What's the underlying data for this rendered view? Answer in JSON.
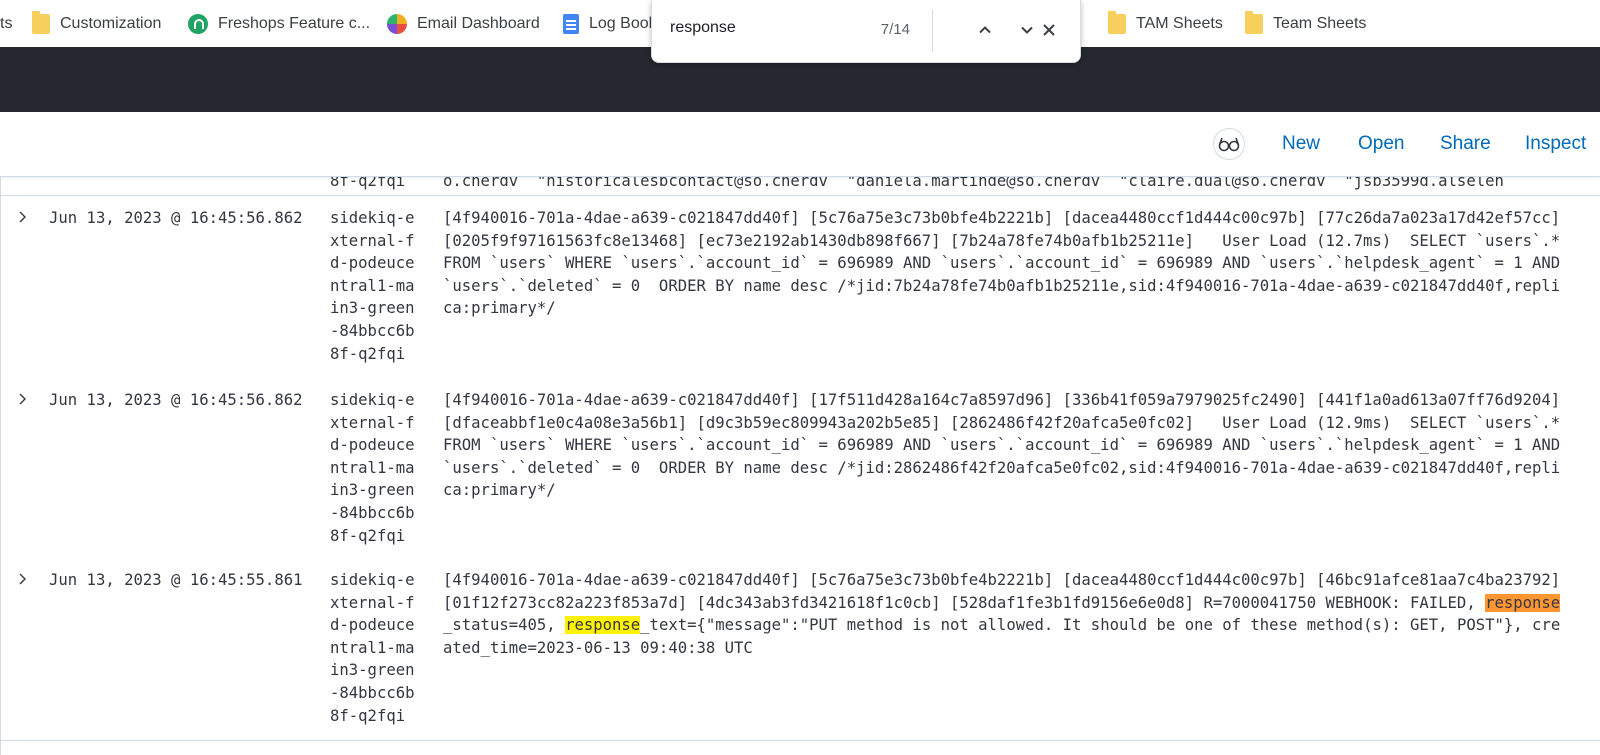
{
  "bookmarks": [
    {
      "label": "ts",
      "icon": "truncated"
    },
    {
      "label": "Customization",
      "icon": "folder-icon"
    },
    {
      "label": "Freshops Feature c...",
      "icon": "headset-icon"
    },
    {
      "label": "Email Dashboard",
      "icon": "dashboard-icon"
    },
    {
      "label": "Log Book",
      "icon": "document-icon"
    },
    {
      "label": "TAM Sheets",
      "icon": "folder-icon"
    },
    {
      "label": "Team Sheets",
      "icon": "folder-icon"
    }
  ],
  "find": {
    "query": "response",
    "count": "7/14"
  },
  "toolbar": {
    "new": "New",
    "open": "Open",
    "share": "Share",
    "inspect": "Inspect"
  },
  "partial_row": {
    "host": "8f-q2fqi",
    "msg": "o.cnerdv  \"historicalesbcontact@so.cnerdv  \"daniela.martinde@so.cnerdv  \"claire.dual@so.cnerdv  \"jsb3599d.alseleh"
  },
  "rows": [
    {
      "timestamp": "Jun 13, 2023 @ 16:45:56.862",
      "host": [
        "sidekiq-e",
        "xternal-f",
        "d-podeuce",
        "ntral1-ma",
        "in3-green",
        "-84bbcc6b",
        "8f-q2fqi"
      ],
      "msg": [
        "[4f940016-701a-4dae-a639-c021847dd40f] [5c76a75e3c73b0bfe4b2221b] [dacea4480ccf1d444c00c97b] [77c26da7a023a17d42ef57cc]",
        "[0205f9f97161563fc8e13468] [ec73e2192ab1430db898f667] [7b24a78fe74b0afb1b25211e]   User Load (12.7ms)  SELECT `users`.*",
        "FROM `users` WHERE `users`.`account_id` = 696989 AND `users`.`account_id` = 696989 AND `users`.`helpdesk_agent` = 1 AND",
        "`users`.`deleted` = 0  ORDER BY name desc /*jid:7b24a78fe74b0afb1b25211e,sid:4f940016-701a-4dae-a639-c021847dd40f,repli",
        "ca:primary*/"
      ]
    },
    {
      "timestamp": "Jun 13, 2023 @ 16:45:56.862",
      "host": [
        "sidekiq-e",
        "xternal-f",
        "d-podeuce",
        "ntral1-ma",
        "in3-green",
        "-84bbcc6b",
        "8f-q2fqi"
      ],
      "msg": [
        "[4f940016-701a-4dae-a639-c021847dd40f] [17f511d428a164c7a8597d96] [336b41f059a7979025fc2490] [441f1a0ad613a07ff76d9204]",
        "[dfaceabbf1e0c4a08e3a56b1] [d9c3b59ec809943a202b5e85] [2862486f42f20afca5e0fc02]   User Load (12.9ms)  SELECT `users`.*",
        "FROM `users` WHERE `users`.`account_id` = 696989 AND `users`.`account_id` = 696989 AND `users`.`helpdesk_agent` = 1 AND",
        "`users`.`deleted` = 0  ORDER BY name desc /*jid:2862486f42f20afca5e0fc02,sid:4f940016-701a-4dae-a639-c021847dd40f,repli",
        "ca:primary*/"
      ]
    },
    {
      "timestamp": "Jun 13, 2023 @ 16:45:55.861",
      "host": [
        "sidekiq-e",
        "xternal-f",
        "d-podeuce",
        "ntral1-ma",
        "in3-green",
        "-84bbcc6b",
        "8f-q2fqi"
      ],
      "msg_line1": "[4f940016-701a-4dae-a639-c021847dd40f] [5c76a75e3c73b0bfe4b2221b] [dacea4480ccf1d444c00c97b] [46bc91afce81aa7c4ba23792]",
      "msg_line2_pre": "[01f12f273cc82a223f853a7d] [4dc343ab3fd3421618f1c0cb] [528daf1fe3b1fd9156e6e0d8] R=7000041750 WEBHOOK: FAILED, ",
      "msg_line2_hl": "response",
      "msg_line3_pre": "_status=405, ",
      "msg_line3_hl": "response",
      "msg_line3_post": "_text={\"message\":\"PUT method is not allowed. It should be one of these method(s): GET, POST\"}, cre",
      "msg_line4": "ated_time=2023-06-13 09:40:38 UTC"
    }
  ],
  "colors": {
    "link": "#006bb8",
    "dark_header": "#25282f",
    "highlight_active": "#ff9632",
    "highlight": "#fff200"
  }
}
